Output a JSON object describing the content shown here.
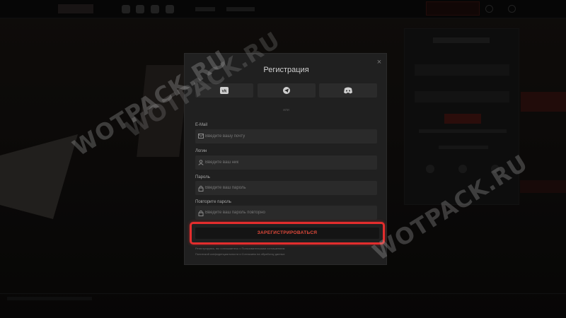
{
  "modal": {
    "title": "Регистрация",
    "close": "×",
    "or": "или",
    "social": [
      "vk-icon",
      "telegram-icon",
      "discord-icon"
    ],
    "fields": [
      {
        "label": "E-Mail",
        "placeholder": "Введите вашу почту",
        "icon": "mail-icon"
      },
      {
        "label": "Логин",
        "placeholder": "Введите ваш ник",
        "icon": "user-icon"
      },
      {
        "label": "Пароль",
        "placeholder": "Введите ваш пароль",
        "icon": "lock-icon"
      },
      {
        "label": "Повторите пароль",
        "placeholder": "Введите ваш пароль повторно",
        "icon": "lock-icon"
      }
    ],
    "submit": "ЗАРЕГИСТРИРОВАТЬСЯ",
    "terms_line1": "Регистрируясь, вы соглашаетесь с Пользовательским соглашением",
    "terms_line2": "Политикой конфиденциальности и Согласием на обработку данных"
  },
  "watermarks": [
    "WOTPACK.RU",
    "WOTPACK.RU",
    "WOTPACK.RU"
  ],
  "colors": {
    "accent": "#e32d2d",
    "submit_text": "#e24a3b",
    "modal_bg": "#202020"
  }
}
